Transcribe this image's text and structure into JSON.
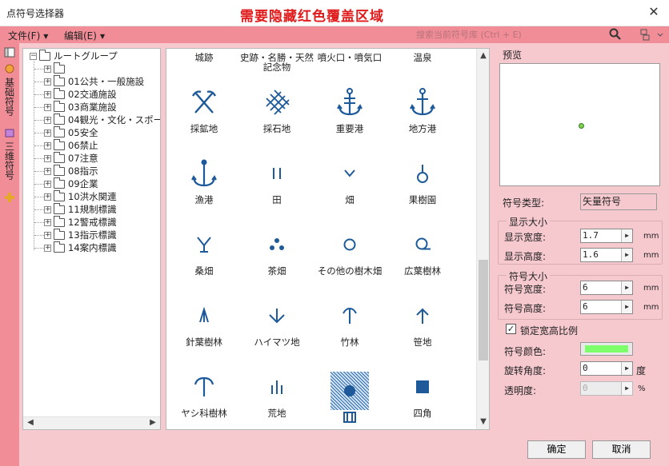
{
  "window": {
    "title": "点符号选择器",
    "notice": "需要隐藏红色覆盖区域",
    "close": "✕"
  },
  "menu": {
    "file": "文件(F)",
    "edit": "编辑(E)"
  },
  "search": {
    "placeholder": "搜索当前符号库 (Ctrl + E)"
  },
  "sidebar": {
    "tabs": [
      "基础符号",
      "三维符号"
    ],
    "add_icon": "plus-icon"
  },
  "tree": {
    "root": "ルートグループ",
    "items": [
      "",
      "01公共・一般施設",
      "02交通施設",
      "03商業施設",
      "04観光・文化・スポー",
      "05安全",
      "06禁止",
      "07注意",
      "08指示",
      "09企業",
      "10洪水関連",
      "11規制標識",
      "12警戒標識",
      "13指示標識",
      "14案内標識"
    ]
  },
  "symbols": {
    "top_row": [
      "城跡",
      "史跡・名勝・天然\n記念物",
      "噴火口・噴気口",
      "温泉"
    ],
    "rows": [
      [
        {
          "label": "採鉱地",
          "icon": "crossed-pickaxes-icon"
        },
        {
          "label": "採石地",
          "icon": "quarry-hatch-icon"
        },
        {
          "label": "重要港",
          "icon": "anchor-double-icon"
        },
        {
          "label": "地方港",
          "icon": "anchor-icon"
        }
      ],
      [
        {
          "label": "漁港",
          "icon": "fishing-port-icon"
        },
        {
          "label": "田",
          "icon": "rice-field-icon"
        },
        {
          "label": "畑",
          "icon": "dry-field-icon"
        },
        {
          "label": "果樹園",
          "icon": "orchard-icon"
        }
      ],
      [
        {
          "label": "桑畑",
          "icon": "mulberry-icon"
        },
        {
          "label": "茶畑",
          "icon": "tea-field-icon"
        },
        {
          "label": "その他の樹木畑",
          "icon": "other-tree-field-icon"
        },
        {
          "label": "広葉樹林",
          "icon": "broadleaf-forest-icon"
        }
      ],
      [
        {
          "label": "針葉樹林",
          "icon": "conifer-forest-icon"
        },
        {
          "label": "ハイマツ地",
          "icon": "creeping-pine-icon"
        },
        {
          "label": "竹林",
          "icon": "bamboo-icon"
        },
        {
          "label": "笹地",
          "icon": "bamboo-grass-icon"
        }
      ],
      [
        {
          "label": "ヤシ科樹林",
          "icon": "palm-icon"
        },
        {
          "label": "荒地",
          "icon": "wasteland-icon"
        },
        {
          "label": "",
          "icon": "circle-icon"
        },
        {
          "label": "四角",
          "icon": "square-icon"
        }
      ]
    ],
    "selected": "circle-icon",
    "accent": "#1e5a9a"
  },
  "props": {
    "preview_label": "预览",
    "type_label": "符号类型:",
    "type_value": "矢量符号",
    "display_group": "显示大小",
    "display_width_label": "显示宽度:",
    "display_width": "1.7",
    "display_height_label": "显示高度:",
    "display_height": "1.6",
    "unit_mm": "mm",
    "symbol_group": "符号大小",
    "symbol_width_label": "符号宽度:",
    "symbol_width": "6",
    "symbol_height_label": "符号高度:",
    "symbol_height": "6",
    "lock_label": "锁定宽高比例",
    "lock_checked": true,
    "color_label": "符号颜色:",
    "color": "#7dff6b",
    "rotation_label": "旋转角度:",
    "rotation": "0",
    "rotation_unit": "度",
    "opacity_label": "透明度:",
    "opacity": "0",
    "opacity_unit": "%"
  },
  "buttons": {
    "ok": "确定",
    "cancel": "取消"
  }
}
